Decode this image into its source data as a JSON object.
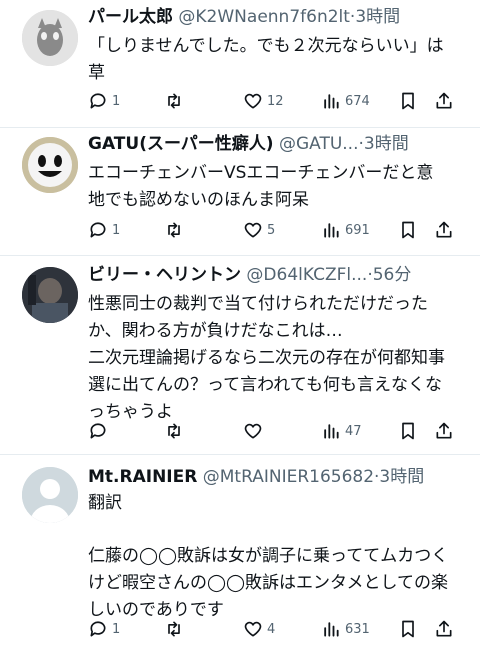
{
  "tweets": [
    {
      "display_name": "パール太郎",
      "handle": "@K2WNaenn7f6n2lt",
      "time": "·3時間",
      "lines": [
        "「しりませんでした。でも２次元ならいい」は",
        "草"
      ],
      "reply_count": "1",
      "retweet_count": "",
      "like_count": "12",
      "view_count": "674",
      "avatar_color": "#d9d9d9"
    },
    {
      "display_name": "GATU(スーパー性癖人)",
      "handle": "@GATU...",
      "time": "·3時間",
      "lines": [
        "エコーチェンバーVSエコーチェンバーだと意",
        "地でも認めないのほんま阿呆"
      ],
      "reply_count": "1",
      "retweet_count": "",
      "like_count": "5",
      "view_count": "691",
      "avatar_color": "#cfc3a6"
    },
    {
      "display_name": "ビリー・ヘリントン",
      "handle": "@D64lKCZFl...",
      "time": "·56分",
      "lines": [
        "性悪同士の裁判で当て付けられただけだった",
        "か、関わる方が負けだなこれは…",
        "二次元理論掲げるなら二次元の存在が何都知事",
        "選に出てんの？って言われても何も言えなくな",
        "っちゃうよ"
      ],
      "reply_count": "",
      "retweet_count": "",
      "like_count": "",
      "view_count": "47",
      "avatar_color": "#3a3f48"
    },
    {
      "display_name": "Mt.RAINIER",
      "handle": "@MtRAINIER165682",
      "time": "·3時間",
      "lines": [
        "翻訳",
        "",
        "仁藤の◯◯敗訴は女が調子に乗っててムカつく",
        "けど暇空さんの◯◯敗訴はエンタメとしての楽",
        "しいのでありです"
      ],
      "reply_count": "1",
      "retweet_count": "",
      "like_count": "4",
      "view_count": "631",
      "avatar_color": "#cfd9de"
    }
  ],
  "colors": {
    "text": "#0f1419",
    "secondary": "#536471",
    "divider": "#e6ecf0"
  },
  "icons": [
    "reply-icon",
    "retweet-icon",
    "like-icon",
    "views-icon",
    "bookmark-icon",
    "share-icon"
  ]
}
